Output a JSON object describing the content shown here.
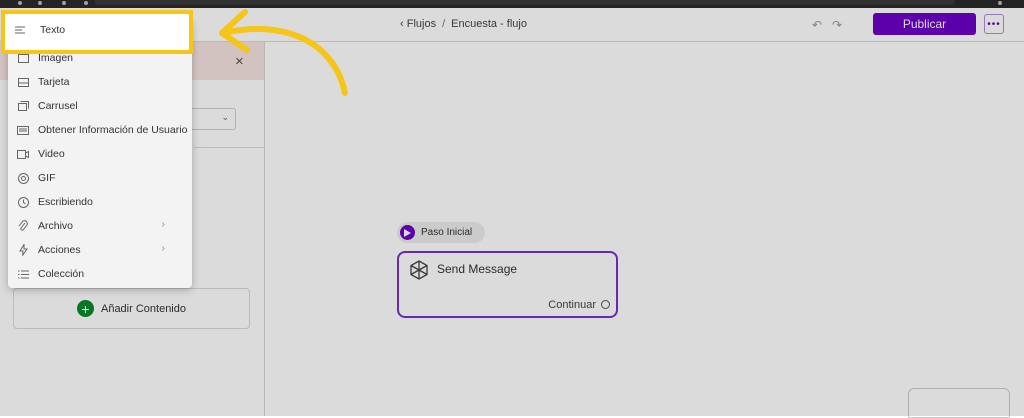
{
  "breadcrumb": {
    "back": "Flujos",
    "separator": "/",
    "current": "Encuesta - flujo"
  },
  "toolbar": {
    "undo_icon": "undo-icon",
    "redo_icon": "redo-icon",
    "publish_label": "Publicar",
    "more_label": "•••"
  },
  "left_panel": {
    "close_label": "×",
    "add_content_label": "Añadir Contenido"
  },
  "menu": {
    "highlighted": {
      "label": "Texto",
      "icon": "text-lines-icon"
    },
    "items": [
      {
        "label": "Imagen",
        "icon": "image-icon"
      },
      {
        "label": "Tarjeta",
        "icon": "card-icon"
      },
      {
        "label": "Carrusel",
        "icon": "carousel-icon"
      },
      {
        "label": "Obtener Información de Usuario",
        "icon": "user-info-icon"
      },
      {
        "label": "Video",
        "icon": "video-icon"
      },
      {
        "label": "GIF",
        "icon": "gif-icon"
      },
      {
        "label": "Escribiendo",
        "icon": "clock-icon"
      },
      {
        "label": "Archivo",
        "icon": "paperclip-icon",
        "submenu": "›"
      },
      {
        "label": "Acciones",
        "icon": "lightning-icon",
        "submenu": "›"
      },
      {
        "label": "Colección",
        "icon": "list-icon"
      }
    ]
  },
  "canvas": {
    "start_label": "Paso Inicial",
    "node": {
      "title": "Send Message",
      "continue_label": "Continuar"
    }
  },
  "colors": {
    "accent": "#6b00c8",
    "highlight": "#f5c518",
    "add_button": "#0a8a2a"
  }
}
